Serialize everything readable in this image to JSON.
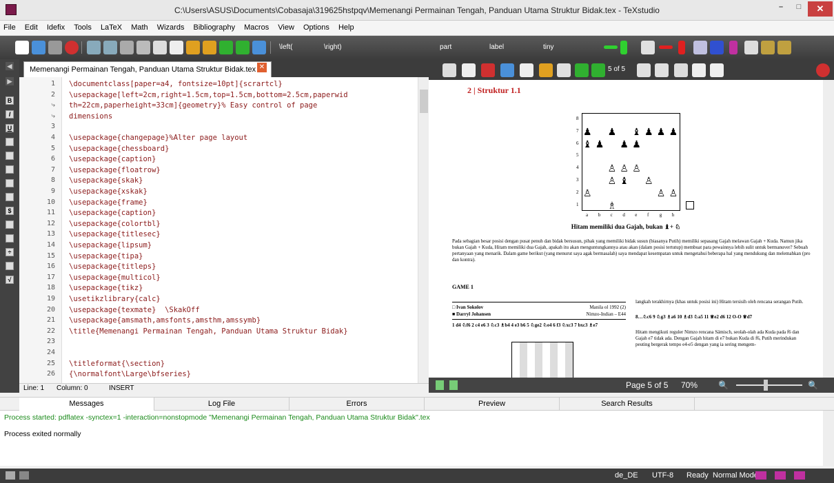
{
  "window": {
    "title": "C:\\Users\\ASUS\\Documents\\Cobasaja\\319625hstpqv\\Memenangi Permainan Tengah, Panduan Utama Struktur Bidak.tex - TeXstudio",
    "min_label": "–",
    "max_label": "□",
    "close_label": "✕"
  },
  "menu": [
    "File",
    "Edit",
    "Idefix",
    "Tools",
    "LaTeX",
    "Math",
    "Wizards",
    "Bibliography",
    "Macros",
    "View",
    "Options",
    "Help"
  ],
  "toolbar": {
    "left": "\\left(",
    "right": "\\right)",
    "part": "part",
    "label": "label",
    "tiny": "tiny"
  },
  "editor": {
    "tab_label": "Memenangi Permainan Tengah, Panduan Utama Struktur Bidak.tex",
    "tab_close": "✕",
    "lines": [
      {
        "n": "1",
        "text": "\\documentclass[paper=a4, fontsize=10pt]{scrartcl}"
      },
      {
        "n": "2",
        "text": "\\usepackage[left=2cm,right=1.5cm,top=1.5cm,bottom=2.5cm,paperwid"
      },
      {
        "n": "⤷",
        "text": "th=22cm,paperheight=33cm]{geometry}% Easy control of page"
      },
      {
        "n": "⤷",
        "text": "dimensions"
      },
      {
        "n": "3",
        "text": ""
      },
      {
        "n": "4",
        "text": "\\usepackage{changepage}%Alter page layout"
      },
      {
        "n": "5",
        "text": "\\usepackage{chessboard}"
      },
      {
        "n": "6",
        "text": "\\usepackage{caption}"
      },
      {
        "n": "7",
        "text": "\\usepackage{floatrow}"
      },
      {
        "n": "8",
        "text": "\\usepackage{skak}"
      },
      {
        "n": "9",
        "text": "\\usepackage{xskak}"
      },
      {
        "n": "10",
        "text": "\\usepackage{frame}"
      },
      {
        "n": "11",
        "text": "\\usepackage{caption}"
      },
      {
        "n": "12",
        "text": "\\usepackage{colortbl}"
      },
      {
        "n": "13",
        "text": "\\usepackage{titlesec}"
      },
      {
        "n": "14",
        "text": "\\usepackage{lipsum}"
      },
      {
        "n": "15",
        "text": "\\usepackage{tipa}"
      },
      {
        "n": "16",
        "text": "\\usepackage{titleps}"
      },
      {
        "n": "17",
        "text": "\\usepackage{multicol}"
      },
      {
        "n": "18",
        "text": "\\usepackage{tikz}"
      },
      {
        "n": "19",
        "text": "\\usetikzlibrary{calc}"
      },
      {
        "n": "20",
        "text": "\\usepackage{texmate}  \\SkakOff"
      },
      {
        "n": "21",
        "text": "\\usepackage{amsmath,amsfonts,amsthm,amssymb}"
      },
      {
        "n": "22",
        "text": "\\title{Memenangi Permainan Tengah, Panduan Utama Struktur Bidak}"
      },
      {
        "n": "23",
        "text": ""
      },
      {
        "n": "24",
        "text": ""
      },
      {
        "n": "25",
        "text": "\\titleformat{\\section}"
      },
      {
        "n": "26",
        "text": "{\\normalfont\\Large\\bfseries}"
      }
    ],
    "status_line": "Line: 1",
    "status_col": "Column: 0",
    "status_mode": "INSERT"
  },
  "preview": {
    "page_label": "5 of 5",
    "heading": "2 | Struktur 1.1",
    "ranks": [
      "8",
      "7",
      "6",
      "5",
      "4",
      "3",
      "2",
      "1"
    ],
    "files": [
      "a",
      "b",
      "c",
      "d",
      "e",
      "f",
      "g",
      "h"
    ],
    "caption": "Hitam memiliki dua Gajah, bukan ♝+ ♘",
    "para": "Pada sebagian besar posisi dengan pusat penuh dan bidak bersusun, pihak yang memiliki bidak susun (biasanya Putih) memiliki sepasang Gajah melawan Gajah + Kuda. Namun jika bukan Gajah + Kuda, Hitam memiliki dua Gajah, apakah itu akan menguntungkannya atau akan (dalam posisi tertutup) membuat para pewainnya lebih sulit untuk bermanuver? Sebuah pertanyaan yang menarik. Dalam game berikut (yang menurut saya agak bermasalah) saya mendapat kesempatan untuk mengetahui beberapa hal yang mendukung dan melemahkan (pro dan kontra).",
    "game_title": "GAME 1",
    "white_player": "Ivan Sokolov",
    "white_info": "Manila ol 1992 (2)",
    "black_player": "Darryl Johansen",
    "black_info": "Nimzo-Indian – E44",
    "moves": "1 d4 ♘f6 2 c4 e6 3 ♘c3 ♗b4 4 e3 b6 5 ♘ge2 ♘e4 6 f3 ♘xc3 7 bxc3 ♗e7",
    "right_col_1": "langkah terakhirnya (khas untuk posisi ini) Hitam tersisih oleh rencana serangan Putih.",
    "right_col_2": "8…♘c6 9 ♘g3 ♗a6 10 ♗d3 ♘a5 11 ♕e2 d6 12 O-O ♕d7",
    "right_col_3": "Hitam mengikuti reguler Nimzo rencana Sämisch, seolah-olah ada Kuda pada f6 dan Gajah e7 tidak ada. Dengan Gajah hitam di e7 bukan Kuda di f6, Putih merindukan peuting bergerak tempo e4-e5 dengan yang ia sering mengem-",
    "status_page": "Page 5 of 5",
    "status_zoom": "70%"
  },
  "bottom_tabs": [
    "Messages",
    "Log File",
    "Errors",
    "Preview",
    "Search Results"
  ],
  "messages": {
    "line1": "Process started: pdflatex -synctex=1 -interaction=nonstopmode \"Memenangi Permainan Tengah, Panduan Utama Struktur Bidak\".tex",
    "line2": "Process exited normally"
  },
  "app_status": {
    "lang": "de_DE",
    "enc": "UTF-8",
    "ready": "Ready",
    "mode": "Normal Mode"
  }
}
